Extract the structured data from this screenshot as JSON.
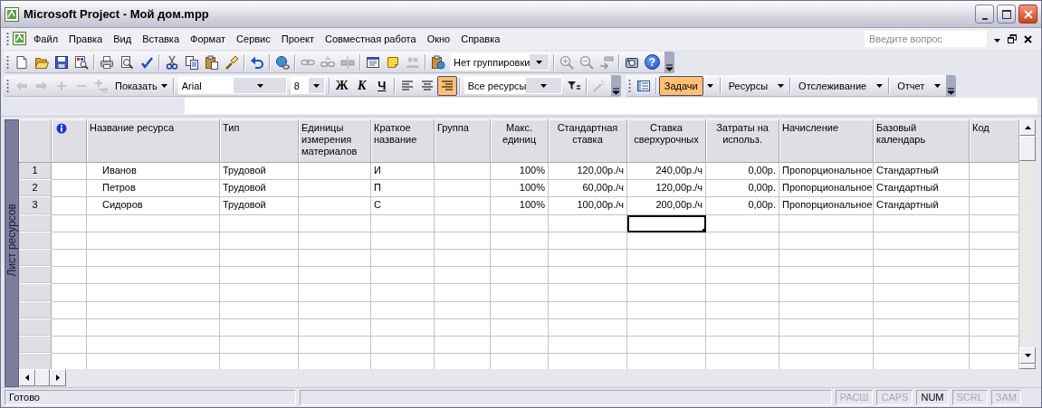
{
  "window": {
    "title": "Microsoft Project - Мой дом.mpp"
  },
  "menu": {
    "items": [
      "Файл",
      "Правка",
      "Вид",
      "Вставка",
      "Формат",
      "Сервис",
      "Проект",
      "Совместная работа",
      "Окно",
      "Справка"
    ],
    "help_box": {
      "placeholder": "Введите вопрос"
    }
  },
  "standard_toolbar": {
    "items": [
      {
        "kind": "new",
        "disabled": false
      },
      {
        "kind": "open",
        "disabled": false
      },
      {
        "kind": "save",
        "disabled": false
      },
      {
        "kind": "find",
        "disabled": false
      },
      {
        "kind": "separator"
      },
      {
        "kind": "print",
        "disabled": false
      },
      {
        "kind": "preview",
        "disabled": false
      },
      {
        "kind": "spell",
        "disabled": false
      },
      {
        "kind": "separator"
      },
      {
        "kind": "cut",
        "disabled": false
      },
      {
        "kind": "copy",
        "disabled": false
      },
      {
        "kind": "paste",
        "disabled": false
      },
      {
        "kind": "painter",
        "disabled": false
      },
      {
        "kind": "separator"
      },
      {
        "kind": "undo",
        "disabled": false
      },
      {
        "kind": "separator"
      },
      {
        "kind": "globe",
        "disabled": false
      },
      {
        "kind": "separator"
      },
      {
        "kind": "link",
        "disabled": true
      },
      {
        "kind": "unlink",
        "disabled": true
      },
      {
        "kind": "splittask",
        "disabled": true
      },
      {
        "kind": "separator"
      },
      {
        "kind": "info",
        "disabled": false
      },
      {
        "kind": "note",
        "disabled": false
      },
      {
        "kind": "assign",
        "disabled": true
      },
      {
        "kind": "separator"
      },
      {
        "kind": "copypic",
        "disabled": false
      },
      {
        "kind": "combo",
        "value": "Нет группировки"
      },
      {
        "kind": "separator"
      },
      {
        "kind": "zoomin",
        "disabled": true
      },
      {
        "kind": "zoomout",
        "disabled": true
      },
      {
        "kind": "goto",
        "disabled": true
      },
      {
        "kind": "separator"
      },
      {
        "kind": "camera",
        "disabled": false
      },
      {
        "kind": "help",
        "label": "?"
      },
      {
        "kind": "options"
      }
    ]
  },
  "formatting_toolbar": {
    "items": [
      {
        "kind": "back",
        "disabled": true
      },
      {
        "kind": "forward",
        "disabled": true
      },
      {
        "kind": "plus",
        "disabled": true
      },
      {
        "kind": "minus",
        "disabled": true
      },
      {
        "kind": "subtasks",
        "disabled": true
      },
      {
        "kind": "menu",
        "label": "Показать"
      },
      {
        "kind": "separator"
      },
      {
        "kind": "combo",
        "value": "Arial"
      },
      {
        "kind": "combo",
        "value": "8"
      },
      {
        "kind": "separator"
      },
      {
        "kind": "bold",
        "label": "Ж",
        "pressed": false
      },
      {
        "kind": "italic",
        "label": "К",
        "pressed": false
      },
      {
        "kind": "underline",
        "label": "Ч",
        "pressed": false
      },
      {
        "kind": "separator"
      },
      {
        "kind": "alignl",
        "pressed": false
      },
      {
        "kind": "alignc",
        "pressed": false
      },
      {
        "kind": "alignr",
        "pressed": true
      },
      {
        "kind": "separator"
      },
      {
        "kind": "combo",
        "value": "Все ресурсы"
      },
      {
        "kind": "filter",
        "disabled": false
      },
      {
        "kind": "separator"
      },
      {
        "kind": "wand",
        "disabled": true
      },
      {
        "kind": "options"
      }
    ]
  },
  "view_toolbar": {
    "items": [
      {
        "kind": "viewbar",
        "disabled": false
      },
      {
        "kind": "separator"
      },
      {
        "kind": "split",
        "label": "Задачи",
        "pressed": true
      },
      {
        "kind": "separator"
      },
      {
        "kind": "split",
        "label": "Ресурсы",
        "pressed": false
      },
      {
        "kind": "separator"
      },
      {
        "kind": "split",
        "label": "Отслеживание",
        "pressed": false
      },
      {
        "kind": "separator"
      },
      {
        "kind": "split",
        "label": "Отчет",
        "pressed": false
      },
      {
        "kind": "options"
      }
    ]
  },
  "sheet": {
    "view_label": "Лист ресурсов",
    "columns": [
      {
        "kind": "indicators"
      },
      {
        "kind": "text",
        "label": "Название ресурса"
      },
      {
        "kind": "text",
        "label": "Тип"
      },
      {
        "kind": "text",
        "label": "Единицы измерения материалов"
      },
      {
        "kind": "text",
        "label": "Краткое название"
      },
      {
        "kind": "text",
        "label": "Группа"
      },
      {
        "kind": "number",
        "label": "Макс. единиц"
      },
      {
        "kind": "number",
        "label": "Стандартная ставка"
      },
      {
        "kind": "number",
        "label": "Ставка сверхурочных"
      },
      {
        "kind": "number",
        "label": "Затраты на использ."
      },
      {
        "kind": "text",
        "label": "Начисление"
      },
      {
        "kind": "text",
        "label": "Базовый календарь"
      },
      {
        "kind": "text",
        "label": "Код"
      }
    ],
    "rows": [
      {
        "id": "1",
        "cells": [
          null,
          "Иванов",
          "Трудовой",
          null,
          "И",
          null,
          "100%",
          "120,00р./ч",
          "240,00р./ч",
          "0,00р.",
          "Пропорциональное",
          "Стандартный",
          null
        ]
      },
      {
        "id": "2",
        "cells": [
          null,
          "Петров",
          "Трудовой",
          null,
          "П",
          null,
          "100%",
          "60,00р./ч",
          "120,00р./ч",
          "0,00р.",
          "Пропорциональное",
          "Стандартный",
          null
        ]
      },
      {
        "id": "3",
        "cells": [
          null,
          "Сидоров",
          "Трудовой",
          null,
          "С",
          null,
          "100%",
          "100,00р./ч",
          "200,00р./ч",
          "0,00р.",
          "Пропорциональное",
          "Стандартный",
          null
        ]
      }
    ],
    "blank_rows": [
      {
        "cells": [
          {
            "selected": false
          },
          {
            "selected": false
          },
          {
            "selected": false
          },
          {
            "selected": false
          },
          {
            "selected": false
          },
          {
            "selected": false
          },
          {
            "selected": false
          },
          {
            "selected": false
          },
          {
            "selected": true
          },
          {
            "selected": false
          },
          {
            "selected": false
          },
          {
            "selected": false
          },
          {
            "selected": false
          }
        ]
      },
      {
        "cells": [
          {
            "selected": false
          },
          {
            "selected": false
          },
          {
            "selected": false
          },
          {
            "selected": false
          },
          {
            "selected": false
          },
          {
            "selected": false
          },
          {
            "selected": false
          },
          {
            "selected": false
          },
          {
            "selected": false
          },
          {
            "selected": false
          },
          {
            "selected": false
          },
          {
            "selected": false
          },
          {
            "selected": false
          }
        ]
      },
      {
        "cells": [
          {
            "selected": false
          },
          {
            "selected": false
          },
          {
            "selected": false
          },
          {
            "selected": false
          },
          {
            "selected": false
          },
          {
            "selected": false
          },
          {
            "selected": false
          },
          {
            "selected": false
          },
          {
            "selected": false
          },
          {
            "selected": false
          },
          {
            "selected": false
          },
          {
            "selected": false
          },
          {
            "selected": false
          }
        ]
      },
      {
        "cells": [
          {
            "selected": false
          },
          {
            "selected": false
          },
          {
            "selected": false
          },
          {
            "selected": false
          },
          {
            "selected": false
          },
          {
            "selected": false
          },
          {
            "selected": false
          },
          {
            "selected": false
          },
          {
            "selected": false
          },
          {
            "selected": false
          },
          {
            "selected": false
          },
          {
            "selected": false
          },
          {
            "selected": false
          }
        ]
      },
      {
        "cells": [
          {
            "selected": false
          },
          {
            "selected": false
          },
          {
            "selected": false
          },
          {
            "selected": false
          },
          {
            "selected": false
          },
          {
            "selected": false
          },
          {
            "selected": false
          },
          {
            "selected": false
          },
          {
            "selected": false
          },
          {
            "selected": false
          },
          {
            "selected": false
          },
          {
            "selected": false
          },
          {
            "selected": false
          }
        ]
      },
      {
        "cells": [
          {
            "selected": false
          },
          {
            "selected": false
          },
          {
            "selected": false
          },
          {
            "selected": false
          },
          {
            "selected": false
          },
          {
            "selected": false
          },
          {
            "selected": false
          },
          {
            "selected": false
          },
          {
            "selected": false
          },
          {
            "selected": false
          },
          {
            "selected": false
          },
          {
            "selected": false
          },
          {
            "selected": false
          }
        ]
      },
      {
        "cells": [
          {
            "selected": false
          },
          {
            "selected": false
          },
          {
            "selected": false
          },
          {
            "selected": false
          },
          {
            "selected": false
          },
          {
            "selected": false
          },
          {
            "selected": false
          },
          {
            "selected": false
          },
          {
            "selected": false
          },
          {
            "selected": false
          },
          {
            "selected": false
          },
          {
            "selected": false
          },
          {
            "selected": false
          }
        ]
      },
      {
        "cells": [
          {
            "selected": false
          },
          {
            "selected": false
          },
          {
            "selected": false
          },
          {
            "selected": false
          },
          {
            "selected": false
          },
          {
            "selected": false
          },
          {
            "selected": false
          },
          {
            "selected": false
          },
          {
            "selected": false
          },
          {
            "selected": false
          },
          {
            "selected": false
          },
          {
            "selected": false
          },
          {
            "selected": false
          }
        ]
      },
      {
        "cells": [
          {
            "selected": false
          },
          {
            "selected": false
          },
          {
            "selected": false
          },
          {
            "selected": false
          },
          {
            "selected": false
          },
          {
            "selected": false
          },
          {
            "selected": false
          },
          {
            "selected": false
          },
          {
            "selected": false
          },
          {
            "selected": false
          },
          {
            "selected": false
          },
          {
            "selected": false
          },
          {
            "selected": false
          }
        ]
      }
    ]
  },
  "status_bar": {
    "message": "Готово",
    "indicators": [
      {
        "label": "РАСШ",
        "on": false
      },
      {
        "label": "CAPS",
        "on": false
      },
      {
        "label": "NUM",
        "on": true
      },
      {
        "label": "SCRL",
        "on": false
      },
      {
        "label": "ЗАМ",
        "on": false
      }
    ]
  }
}
